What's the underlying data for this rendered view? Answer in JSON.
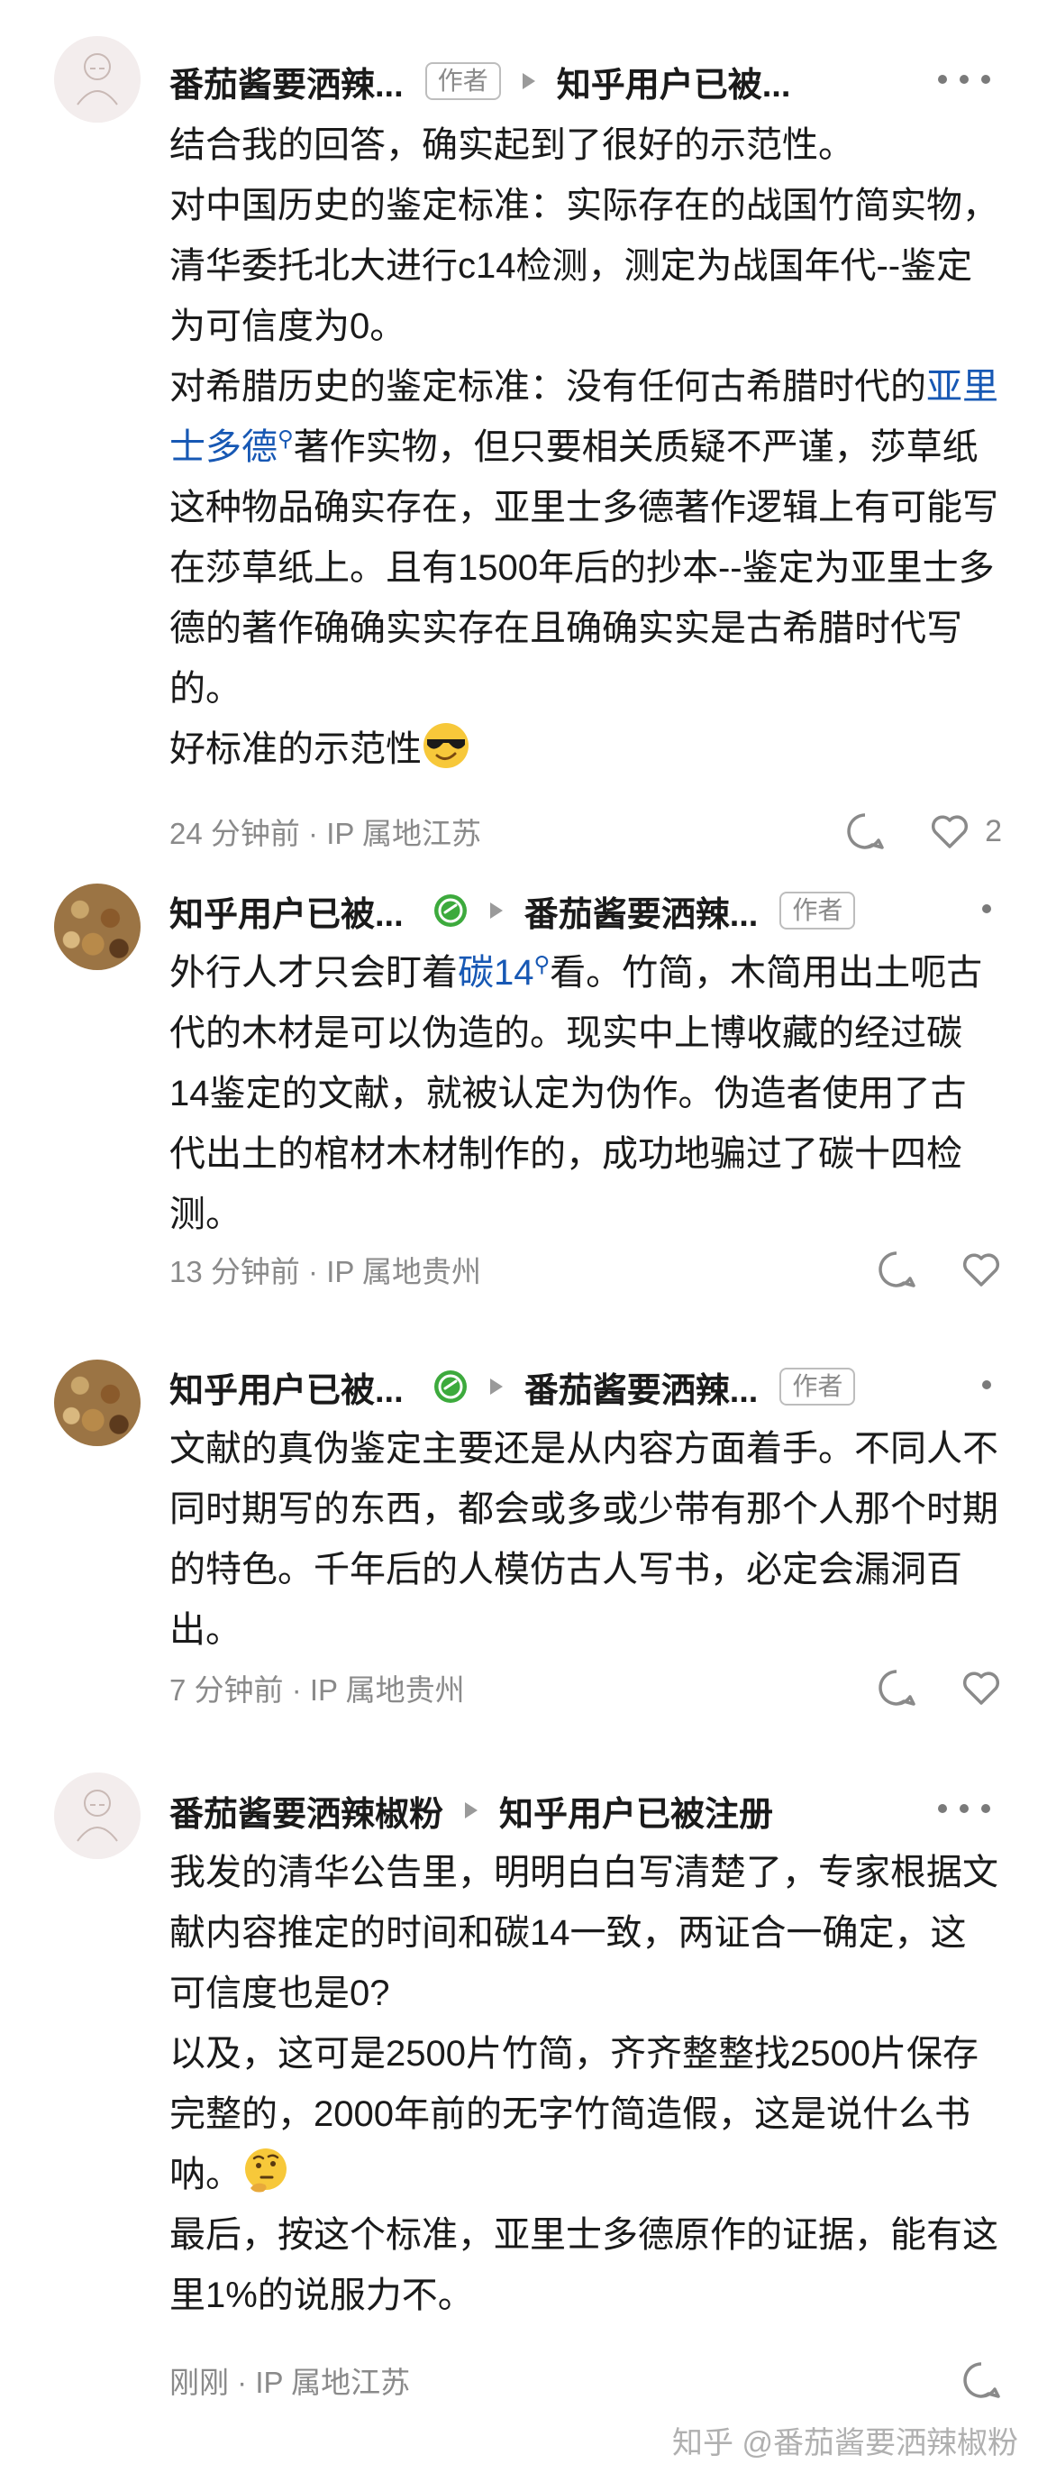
{
  "comments": [
    {
      "author": "番茄酱要洒辣...",
      "author_badge": "作者",
      "reply_to": "知乎用户已被...",
      "paragraphs": {
        "p1": "结合我的回答，确实起到了很好的示范性。",
        "p2": "对中国历史的鉴定标准：实际存在的战国竹简实物，清华委托北大进行c14检测，测定为战国年代--鉴定为可信度为0。",
        "p3_pre": "对希腊历史的鉴定标准：没有任何古希腊时代的",
        "p3_link": "亚里士多德",
        "p3_post": "著作实物，但只要相关质疑不严谨，莎草纸这种物品确实存在，亚里士多德著作逻辑上有可能写在莎草纸上。且有1500年后的抄本--鉴定为亚里士多德的著作确确实实存在且确确实实是古希腊时代写的。",
        "p4": "好标准的示范性"
      },
      "time": "24 分钟前 · IP 属地江苏",
      "likes": "2",
      "emoji": "sunglasses-emoji"
    },
    {
      "author": "知乎用户已被...",
      "reply_to": "番茄酱要洒辣...",
      "reply_to_badge": "作者",
      "paragraphs": {
        "p1_pre": "外行人才只会盯着",
        "p1_link": "碳14",
        "p1_post": "看。竹简，木简用出土呃古代的木材是可以伪造的。现实中上博收藏的经过碳14鉴定的文献，就被认定为伪作。伪造者使用了古代出土的棺材木材制作的，成功地骗过了碳十四检测。"
      },
      "time": "13 分钟前 · IP 属地贵州"
    },
    {
      "author": "知乎用户已被...",
      "reply_to": "番茄酱要洒辣...",
      "reply_to_badge": "作者",
      "paragraphs": {
        "p1": "文献的真伪鉴定主要还是从内容方面着手。不同人不同时期写的东西，都会或多或少带有那个人那个时期的特色。千年后的人模仿古人写书，必定会漏洞百出。"
      },
      "time": "7 分钟前 · IP 属地贵州"
    },
    {
      "author": "番茄酱要洒辣椒粉",
      "reply_to": "知乎用户已被注册",
      "paragraphs": {
        "p1": "我发的清华公告里，明明白白写清楚了，专家根据文献内容推定的时间和碳14一致，两证合一确定，这可信度也是0?",
        "p2": "以及，这可是2500片竹简，齐齐整整找2500片保存完整的，2000年前的无字竹简造假，这是说什么书呐。",
        "p3": "最后，按这个标准，亚里士多德原作的证据，能有这里1%的说服力不。"
      },
      "time": "刚刚 · IP 属地江苏",
      "emoji": "thinking-emoji"
    }
  ],
  "watermark": "知乎 @番茄酱要洒辣椒粉",
  "colors": {
    "link": "#1758b4",
    "meta_text": "#8a8a8a",
    "verified_badge": "#3daa3d"
  }
}
